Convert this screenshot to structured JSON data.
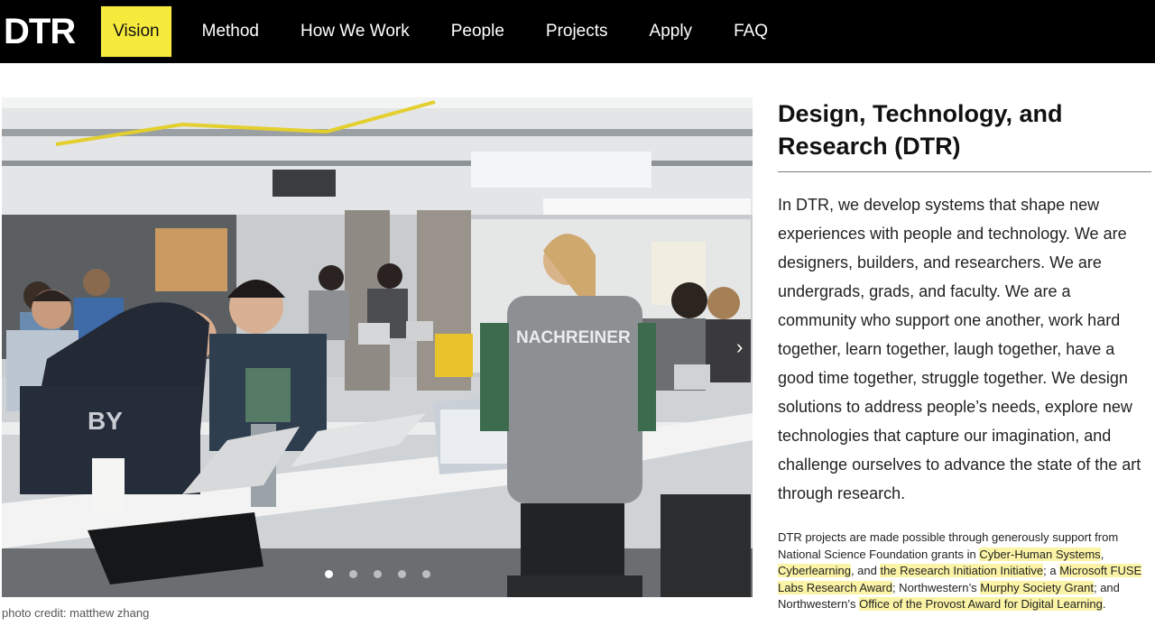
{
  "nav": {
    "logo": "DTR",
    "items": [
      {
        "label": "Vision",
        "active": true
      },
      {
        "label": "Method"
      },
      {
        "label": "How We Work"
      },
      {
        "label": "People"
      },
      {
        "label": "Projects"
      },
      {
        "label": "Apply"
      },
      {
        "label": "FAQ"
      }
    ]
  },
  "photo": {
    "jersey_text": "NACHREINER",
    "credit": "photo credit: matthew zhang",
    "slide_count": 5,
    "active_slide": 1
  },
  "main": {
    "title": "Design, Technology, and Research (DTR)",
    "intro": "In DTR, we develop systems that shape new experiences with people and technology. We are designers, builders, and researchers. We are undergrads, grads, and faculty. We are a community who support one another, work hard together, learn together, laugh together, have a good time together, struggle together. We design solutions to address people’s needs, explore new technologies that capture our imagination, and challenge ourselves to advance the state of the art through research.",
    "funding": {
      "t1": "DTR projects are made possible through generously support from National Science Foundation grants in ",
      "l1": "Cyber-Human Systems",
      "t2": ", ",
      "l2": "Cyberlearning",
      "t3": ", and ",
      "l3": "the Research Initiation Initiative",
      "t4": "; a ",
      "l4": "Microsoft FUSE Labs Research Award",
      "t5": "; Northwestern’s ",
      "l5": "Murphy Society Grant",
      "t6": "; and Northwestern’s ",
      "l6": "Office of the Provost Award for Digital Learning",
      "t7": "."
    }
  },
  "colors": {
    "nav_bg": "#000000",
    "active_tab": "#f6ea3d",
    "link_highlight": "#fbf4a6"
  }
}
